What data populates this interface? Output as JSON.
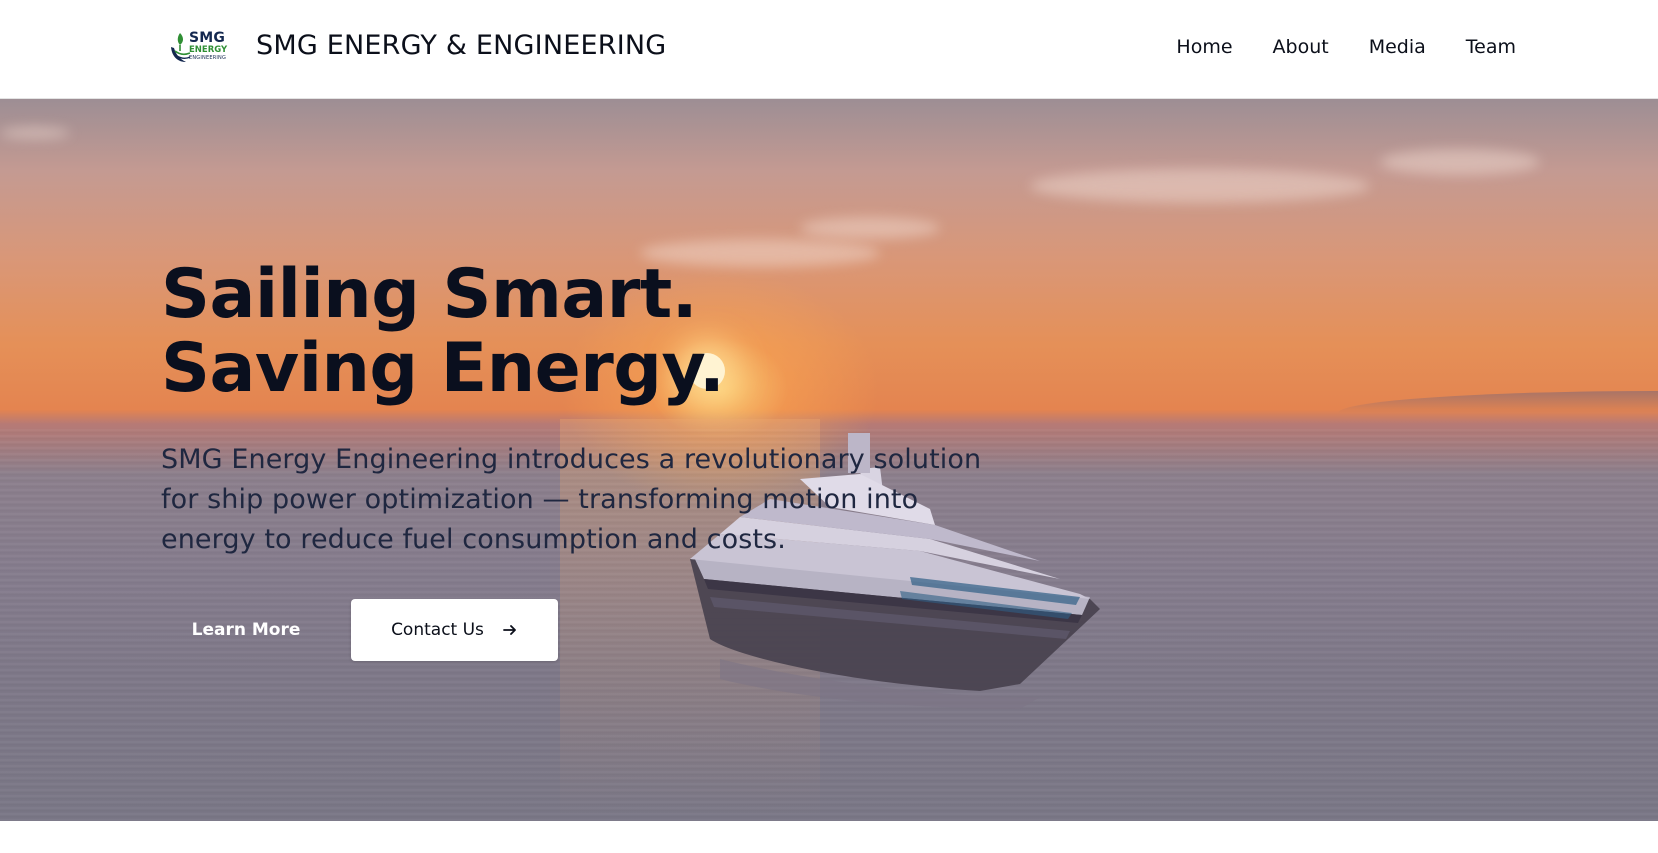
{
  "header": {
    "logo": {
      "line1": "SMG",
      "line2": "ENERGY",
      "line3": "ENGINEERING"
    },
    "brand_title": "SMG ENERGY & ENGINEERING",
    "nav": [
      {
        "label": "Home"
      },
      {
        "label": "About"
      },
      {
        "label": "Media"
      },
      {
        "label": "Team"
      }
    ]
  },
  "hero": {
    "headline_line1": "Sailing Smart.",
    "headline_line2": "Saving Energy.",
    "subtext": "SMG Energy Engineering introduces a revolutionary solution for ship power optimization — transforming motion into energy to reduce fuel consumption and costs.",
    "learn_more_label": "Learn More",
    "contact_label": "Contact Us"
  },
  "colors": {
    "logo_navy": "#14284f",
    "logo_green": "#2f8f34",
    "headline": "#0a0f1e",
    "button_bg": "#ffffff"
  },
  "icons": {
    "logo": "leaf-ship-logo-icon",
    "contact_arrow": "arrow-right-icon"
  }
}
